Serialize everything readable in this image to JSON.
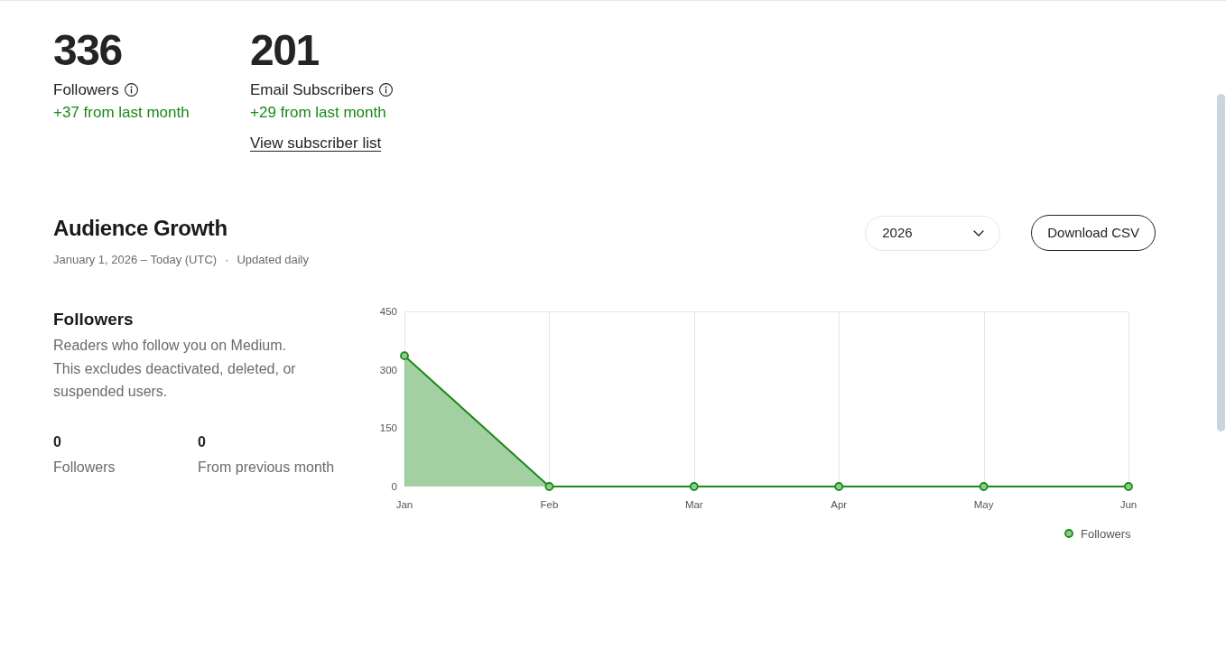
{
  "stats": [
    {
      "value": "336",
      "label": "Followers",
      "change": "+37 from last month"
    },
    {
      "value": "201",
      "label": "Email Subscribers",
      "change": "+29 from last month",
      "link": "View subscriber list"
    }
  ],
  "audience_growth": {
    "title": "Audience Growth",
    "date_range": "January 1, 2026 – Today (UTC)",
    "separator": "·",
    "update_note": "Updated daily",
    "year_select": {
      "value": "2026"
    },
    "download_button": "Download CSV"
  },
  "followers_panel": {
    "title": "Followers",
    "description": "Readers who follow you on Medium. This excludes deactivated, deleted, or suspended users.",
    "metrics": [
      {
        "value": "0",
        "label": "Followers"
      },
      {
        "value": "0",
        "label": "From previous month"
      }
    ],
    "chart_data": [
      {
        "type": "area",
        "categories": [
          "Jan",
          "Feb",
          "Mar",
          "Apr",
          "May",
          "Jun"
        ],
        "series": [
          {
            "name": "Followers",
            "color": "#1a8917",
            "values": [
              336,
              0,
              0,
              0,
              0,
              0
            ]
          }
        ],
        "ylim": [
          0,
          450
        ],
        "yticks": [
          0,
          150,
          300,
          450
        ],
        "grid": "x",
        "legend": "bottom-right",
        "marker": "circle"
      }
    ]
  }
}
